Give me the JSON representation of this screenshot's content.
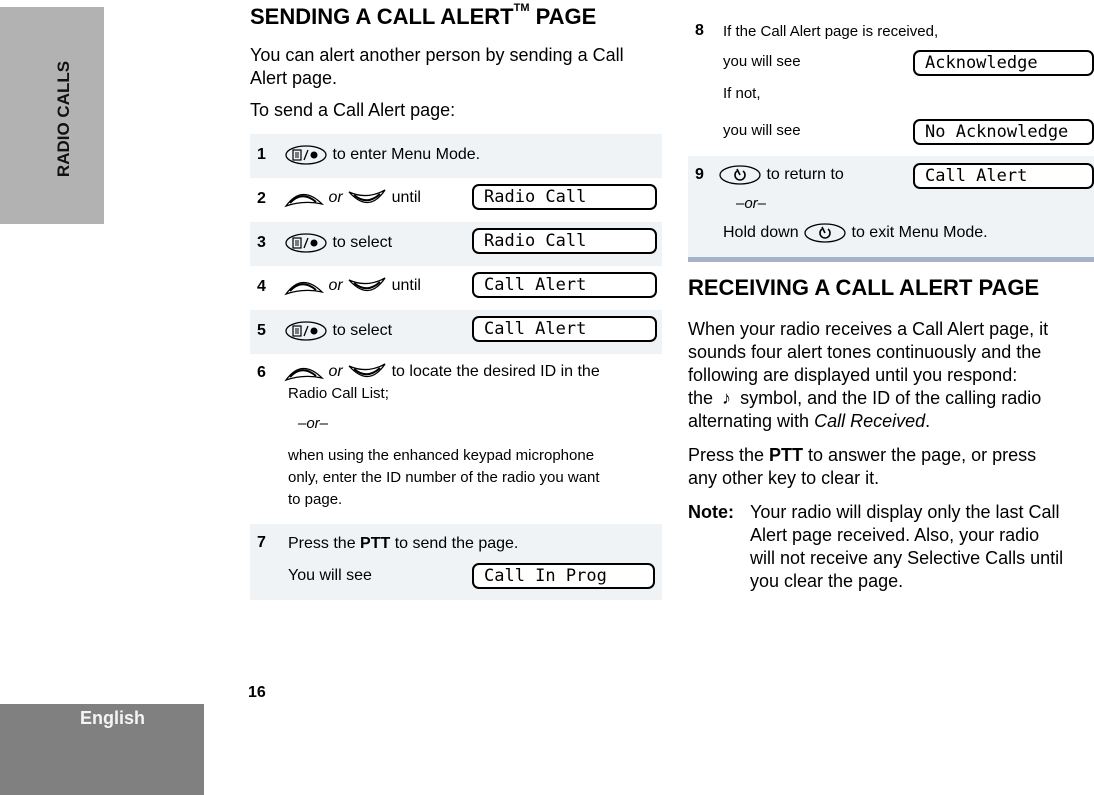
{
  "side_tabs": {
    "section": "RADIO CALLS",
    "language": "English"
  },
  "page_number": "16",
  "sending": {
    "title": "SENDING A CALL ALERT",
    "title_tm": "TM",
    "title_suffix": " PAGE",
    "intro": "You can alert another person by sending a Call Alert page.",
    "lead": "To send a Call Alert page:",
    "steps": [
      {
        "num": "1",
        "text": "to enter Menu Mode.",
        "icon": "menu-select-key-icon"
      },
      {
        "num": "2",
        "or": "or",
        "text": "until",
        "display": "Radio Call",
        "icon": "up-down-keys-icon"
      },
      {
        "num": "3",
        "text": "to select",
        "display": "Radio Call",
        "icon": "menu-select-key-icon"
      },
      {
        "num": "4",
        "or": "or",
        "text": "until",
        "display": "Call Alert",
        "icon": "up-down-keys-icon"
      },
      {
        "num": "5",
        "text": "to select",
        "display": "Call Alert",
        "icon": "menu-select-key-icon"
      },
      {
        "num": "6",
        "or": "or",
        "text": "to locate the desired ID in the",
        "text2": "Radio Call List;",
        "alt": "–or–",
        "text3": "when using the enhanced keypad microphone",
        "text4": "only, enter the ID number of the radio you want",
        "text5": "to page.",
        "icon": "up-down-keys-icon"
      },
      {
        "num": "7",
        "pre": "Press the ",
        "bold": "PTT",
        "post": " to send the page.",
        "see": "You will see",
        "display": "Call In Prog"
      },
      {
        "num": "8",
        "text": "If the Call Alert page is received,",
        "see": "you will see",
        "display": "Acknowledge",
        "ifnot": "If not,",
        "see2": "you will see",
        "display2": "No Acknowledge"
      },
      {
        "num": "9",
        "text": "to return to",
        "display": "Call Alert",
        "alt": "–or–",
        "hold_pre": "Hold down",
        "hold_post": "to exit Menu Mode.",
        "icon": "home-exit-key-icon"
      }
    ]
  },
  "receiving": {
    "title": "RECEIVING A CALL ALERT PAGE",
    "p1_l1": "When your radio receives a Call Alert page, it",
    "p1_l2": "sounds four alert tones continuously and the",
    "p1_l3": "following are displayed until you respond:",
    "p1_l4a": "the",
    "p1_l4b": "symbol, and the ID of the calling radio",
    "p1_l5a": "alternating with ",
    "p1_l5b": "Call Received",
    "p1_l5c": ".",
    "note_symbol": "♪",
    "p2_pre": "Press the ",
    "p2_bold": "PTT",
    "p2_post": " to answer the page, or press",
    "p2_l2": "any other key to clear it.",
    "note_label": "Note:",
    "note_l1": "Your radio will display only the last Call",
    "note_l2": "Alert page received. Also, your radio",
    "note_l3": "will not receive any Selective Calls until",
    "note_l4": "you clear the page."
  }
}
